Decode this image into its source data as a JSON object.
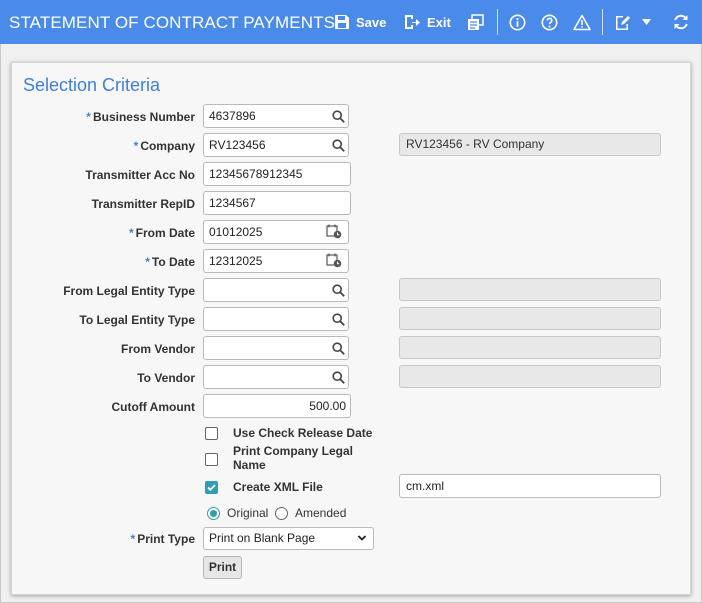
{
  "header": {
    "title": "STATEMENT OF CONTRACT PAYMENTS",
    "save_label": "Save",
    "exit_label": "Exit"
  },
  "section": {
    "title": "Selection Criteria"
  },
  "fields": {
    "business_number": {
      "label": "Business Number",
      "value": "4637896"
    },
    "company": {
      "label": "Company",
      "value": "RV123456",
      "description": "RV123456 - RV Company"
    },
    "transmitter_acc_no": {
      "label": "Transmitter Acc No",
      "value": "12345678912345"
    },
    "transmitter_repid": {
      "label": "Transmitter RepID",
      "value": "1234567"
    },
    "from_date": {
      "label": "From Date",
      "value": "01012025"
    },
    "to_date": {
      "label": "To Date",
      "value": "12312025"
    },
    "from_legal_entity_type": {
      "label": "From Legal Entity Type",
      "value": "",
      "description": ""
    },
    "to_legal_entity_type": {
      "label": "To Legal Entity Type",
      "value": "",
      "description": ""
    },
    "from_vendor": {
      "label": "From Vendor",
      "value": "",
      "description": ""
    },
    "to_vendor": {
      "label": "To Vendor",
      "value": "",
      "description": ""
    },
    "cutoff_amount": {
      "label": "Cutoff Amount",
      "value": "500.00"
    },
    "use_check_release_date": {
      "label": "Use Check Release Date",
      "checked": false
    },
    "print_company_legal_name": {
      "label_line1": "Print Company Legal",
      "label_line2": "Name",
      "checked": false
    },
    "create_xml_file": {
      "label": "Create XML File",
      "checked": true,
      "filename": "cm.xml"
    },
    "version": {
      "original_label": "Original",
      "amended_label": "Amended",
      "selected": "Original"
    },
    "print_type": {
      "label": "Print Type",
      "value": "Print on Blank Page"
    },
    "print_button_label": "Print"
  },
  "required_marker": "*",
  "colors": {
    "header_bg": "#4a8ae8",
    "accent": "#3f7fd6",
    "checkbox": "#2e9fb0"
  }
}
